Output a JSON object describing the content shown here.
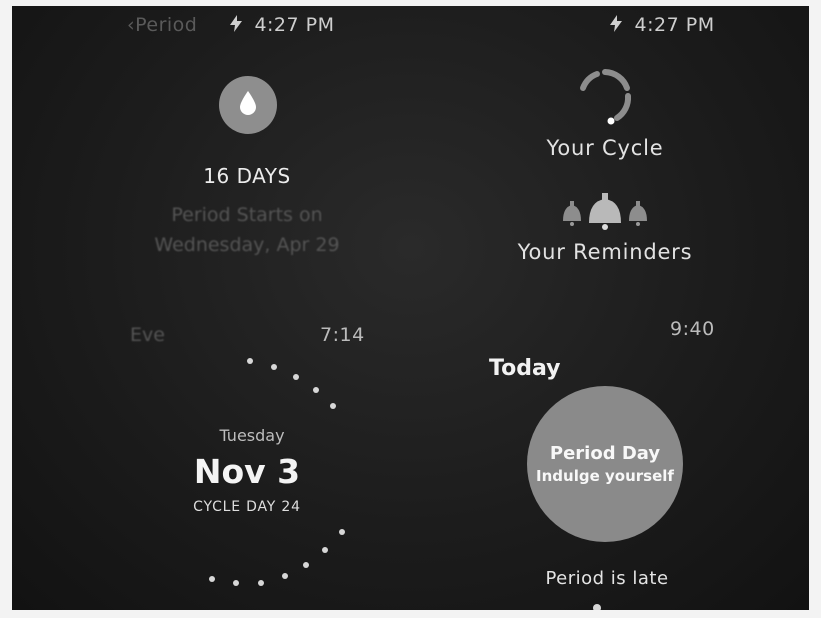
{
  "left_watch": {
    "status": {
      "back_label": "‹Period",
      "time": "4:27 PM"
    },
    "summary": {
      "days": "16 DAYS",
      "line1": "Period Starts on",
      "line2": "Wednesday, Apr 29"
    },
    "row": {
      "label": "Eve",
      "time": "7:14"
    },
    "date_card": {
      "weekday": "Tuesday",
      "date": "Nov 3",
      "cycle_day": "CYCLE DAY 24"
    }
  },
  "right_watch": {
    "status": {
      "time": "4:27 PM"
    },
    "menu": {
      "cycle_label": "Your Cycle",
      "reminders_label": "Your Reminders"
    },
    "time": "9:40",
    "today_label": "Today",
    "period_card": {
      "title": "Period Day",
      "subtitle": "Indulge yourself"
    },
    "status_message": "Period is late"
  },
  "icons": {
    "drop": "water-drop-icon",
    "cycle": "cycle-ring-icon",
    "reminders": "bells-icon",
    "charging": "lightning-bolt-icon"
  },
  "colors": {
    "screen_bg": "#1c1c1c",
    "accent_circle": "#8a8a8a",
    "text_primary": "#f2f2f2"
  }
}
